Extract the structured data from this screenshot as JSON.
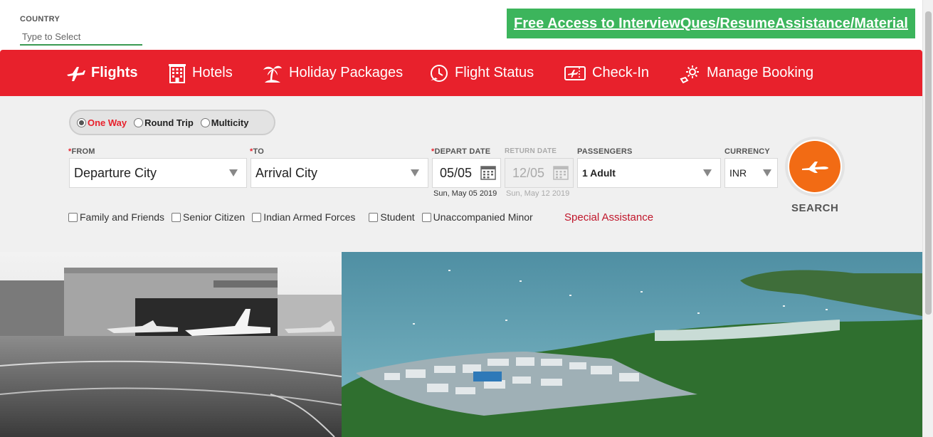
{
  "country": {
    "label": "COUNTRY",
    "placeholder": "Type to Select"
  },
  "promo": {
    "text": "Free Access to InterviewQues/ResumeAssistance/Material"
  },
  "nav": {
    "items": [
      {
        "label": "Flights",
        "icon": "plane-icon",
        "active": true
      },
      {
        "label": "Hotels",
        "icon": "hotel-icon"
      },
      {
        "label": "Holiday Packages",
        "icon": "palm-tree-icon"
      },
      {
        "label": "Flight Status",
        "icon": "flight-status-icon"
      },
      {
        "label": "Check-In",
        "icon": "ticket-icon"
      },
      {
        "label": "Manage Booking",
        "icon": "gear-icon"
      }
    ]
  },
  "trip_type": {
    "options": [
      "One Way",
      "Round Trip",
      "Multicity"
    ],
    "selected": "One Way"
  },
  "form": {
    "from": {
      "label": "FROM",
      "value": "Departure City"
    },
    "to": {
      "label": "TO",
      "value": "Arrival City"
    },
    "depart": {
      "label": "DEPART DATE",
      "value": "05/05",
      "sub": "Sun, May 05 2019"
    },
    "return": {
      "label": "RETURN DATE",
      "value": "12/05",
      "sub": "Sun, May 12 2019"
    },
    "passengers": {
      "label": "PASSENGERS",
      "value": "1 Adult"
    },
    "currency": {
      "label": "CURRENCY",
      "value": "INR"
    },
    "search_label": "SEARCH"
  },
  "discounts": [
    "Family and Friends",
    "Senior Citizen",
    "Indian Armed Forces",
    "Student",
    "Unaccompanied Minor"
  ],
  "special_assistance": "Special Assistance",
  "colors": {
    "brand_red": "#e8212c",
    "promo_green": "#3cb55c",
    "search_orange": "#f26b14"
  }
}
